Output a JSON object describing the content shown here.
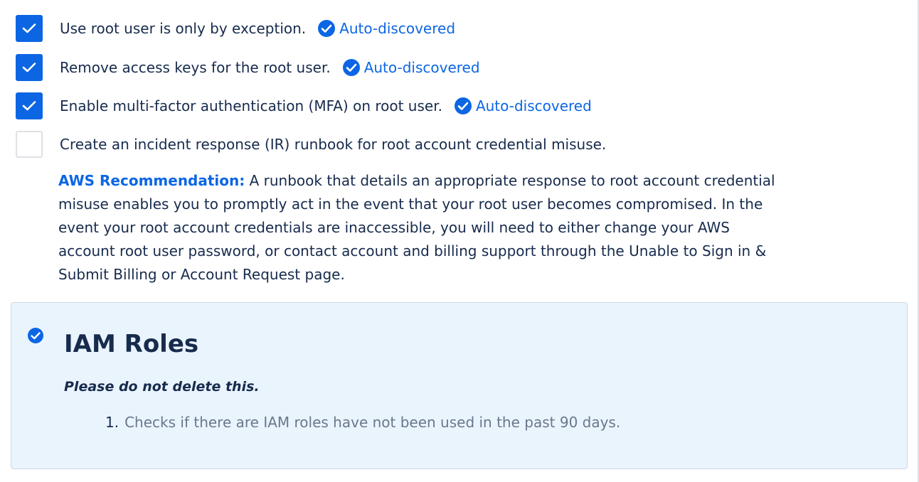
{
  "checklist": [
    {
      "label": "Use root user is only by exception.",
      "checked": true,
      "badge": "Auto-discovered"
    },
    {
      "label": "Remove access keys for the root user.",
      "checked": true,
      "badge": "Auto-discovered"
    },
    {
      "label": "Enable multi-factor authentication (MFA) on root user.",
      "checked": true,
      "badge": "Auto-discovered"
    },
    {
      "label": "Create an incident response (IR) runbook for root account credential misuse.",
      "checked": false,
      "badge": ""
    }
  ],
  "recommendation": {
    "label": "AWS Recommendation:",
    "lines": [
      " A runbook that details an appropriate response to root account credential",
      "misuse enables you to promptly act in the event that your root user becomes compromised. In the",
      "event your root account credentials are inaccessible, you will need to either change your AWS",
      "account root user password, or contact account and billing support through the Unable to Sign in &",
      "Submit Billing or Account Request page."
    ]
  },
  "panel": {
    "title": "IAM Roles",
    "note": "Please do not delete this.",
    "items": [
      {
        "number": "1.",
        "text": "Checks if there are IAM roles have not been used in the past 90 days."
      }
    ]
  },
  "colors": {
    "accent": "#0c66e4",
    "panel_bg": "#eaf4fd",
    "text": "#172b4d",
    "muted": "#6b778c"
  },
  "icons": {
    "checkbox_check": "checkmark-icon",
    "badge": "check-circle-icon",
    "panel": "check-circle-icon"
  }
}
